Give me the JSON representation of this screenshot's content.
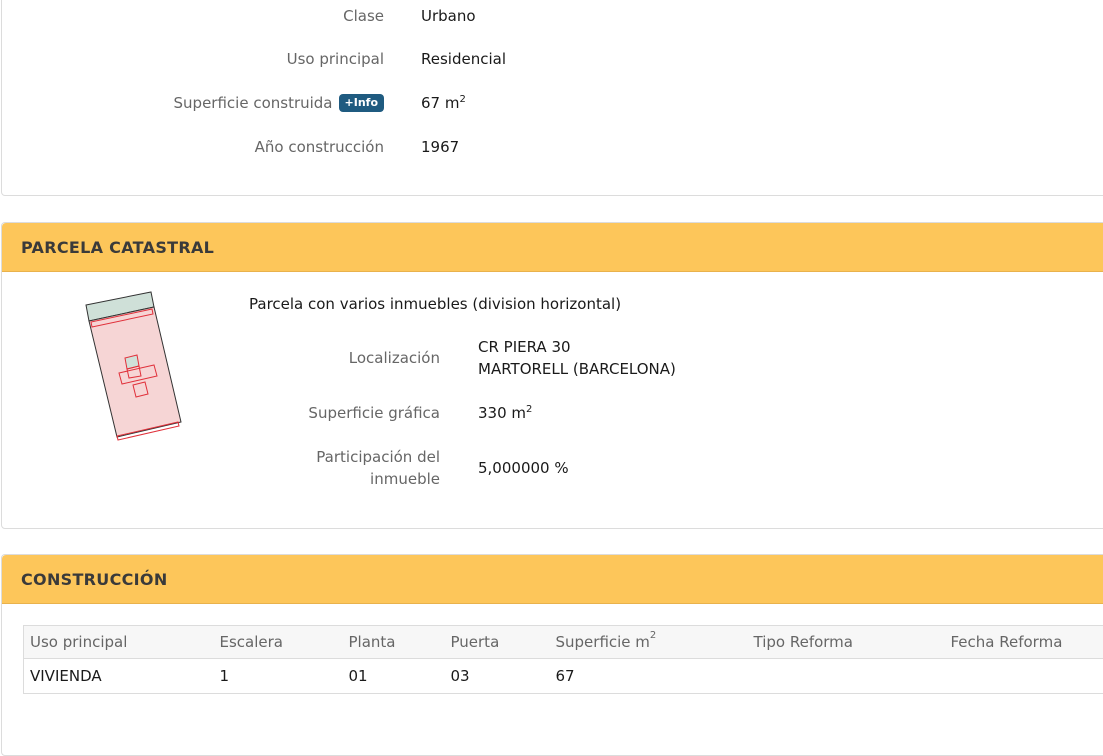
{
  "inmueble": {
    "clase_label": "Clase",
    "clase_value": "Urbano",
    "uso_label": "Uso principal",
    "uso_value": "Residencial",
    "superficie_label": "Superficie construida",
    "info_button": "+Info",
    "superficie_value": "67 m",
    "superficie_unit_exp": "2",
    "anio_label": "Año construcción",
    "anio_value": "1967"
  },
  "parcela": {
    "title": "PARCELA CATASTRAL",
    "description": "Parcela con varios inmuebles (division horizontal)",
    "localizacion_label": "Localización",
    "localizacion_line1": "CR PIERA 30",
    "localizacion_line2": "MARTORELL (BARCELONA)",
    "sup_grafica_label": "Superficie gráfica",
    "sup_grafica_value": "330 m",
    "sup_grafica_exp": "2",
    "participacion_label_1": "Participación del",
    "participacion_label_2": "inmueble",
    "participacion_value": "5,000000 %"
  },
  "construccion": {
    "title": "CONSTRUCCIÓN",
    "headers": [
      "Uso principal",
      "Escalera",
      "Planta",
      "Puerta",
      "Superficie m",
      "Tipo Reforma",
      "Fecha Reforma"
    ],
    "header_exp": "2",
    "rows": [
      [
        "VIVIENDA",
        "1",
        "01",
        "03",
        "67",
        "",
        ""
      ]
    ]
  },
  "colors": {
    "header_bg": "#fdc65a",
    "info_button_bg": "#1f5b80",
    "parcel_fill": "#f6d5d5",
    "parcel_stroke": "#e0303a",
    "green_area": "#cfe0d8"
  }
}
